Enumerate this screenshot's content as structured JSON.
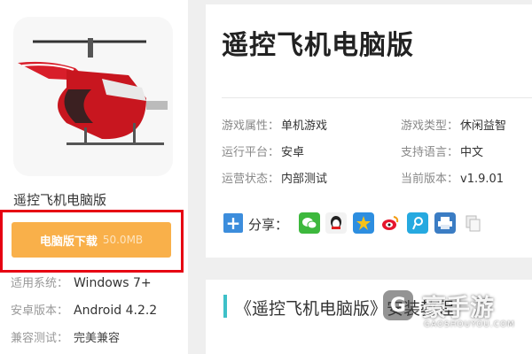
{
  "app": {
    "name": "遥控飞机电脑版",
    "thumbnail_icon": "helicopter-icon"
  },
  "download": {
    "label": "电脑版下载",
    "size": "50.0MB",
    "color": "#f9b04a",
    "highlight_color": "#e60012"
  },
  "sidebar_info": [
    {
      "label": "适用系统：",
      "value": "Windows 7+"
    },
    {
      "label": "安卓版本：",
      "value": "Android 4.2.2"
    },
    {
      "label": "兼容测试：",
      "value": "完美兼容"
    }
  ],
  "title": "遥控飞机电脑版",
  "attributes": [
    {
      "label": "游戏属性：",
      "value": "单机游戏"
    },
    {
      "label": "游戏类型：",
      "value": "休闲益智"
    },
    {
      "label": "运行平台：",
      "value": "安卓"
    },
    {
      "label": "支持语言：",
      "value": "中文"
    },
    {
      "label": "运营状态：",
      "value": "内部测试"
    },
    {
      "label": "当前版本：",
      "value": "v1.9.01"
    }
  ],
  "share": {
    "label": "分享：",
    "icons": [
      "wechat-icon",
      "qq-icon",
      "qzone-icon",
      "weibo-icon",
      "tencent-weibo-icon",
      "print-icon",
      "copy-icon"
    ]
  },
  "tutorial": {
    "title": "《遥控飞机电脑版》安装教程",
    "accent": "#3ec0c8"
  },
  "watermark": {
    "name": "豪手游",
    "url": "GAOSHOUYOU.COM"
  }
}
